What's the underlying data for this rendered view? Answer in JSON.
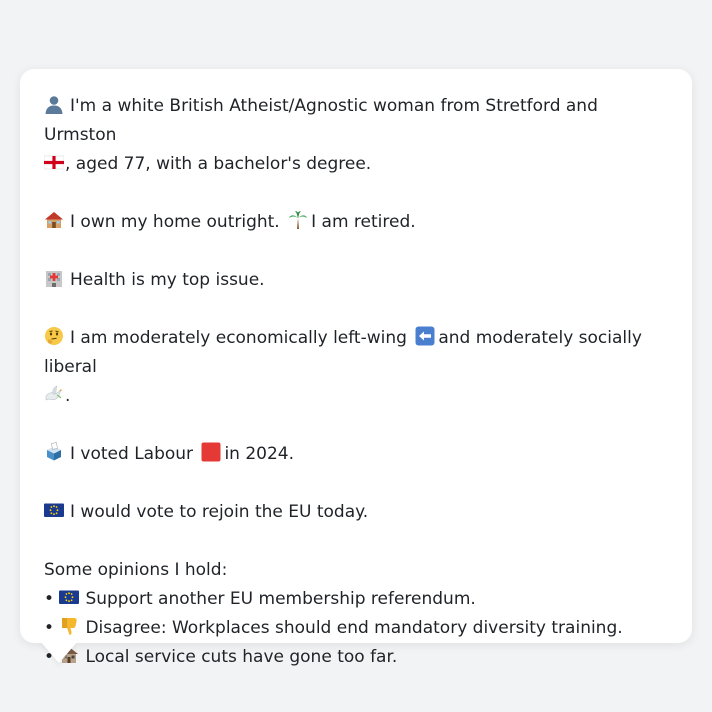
{
  "profile": {
    "identity_text": "I'm a white British Atheist/Agnostic woman from Stretford and Urmston",
    "identity_text_cont": ", aged 77, with a bachelor's degree.",
    "home_text": "I own my home outright.",
    "retired_text": "I am retired.",
    "issue_text": "Health is my top issue.",
    "economics_text_a": "I am moderately economically left-wing",
    "economics_text_b": "and moderately socially liberal",
    "economics_text_end": ".",
    "vote_text_a": "I voted Labour",
    "vote_text_b": "in 2024.",
    "eu_text": "I would vote to rejoin the EU today.",
    "opinions_heading": "Some opinions I hold:",
    "opinions": [
      {
        "bullet": "•",
        "text": "Support another EU membership referendum."
      },
      {
        "bullet": "•",
        "text": "Disagree: Workplaces should end mandatory diversity training."
      },
      {
        "bullet": "•",
        "text": "Local service cuts have gone too far."
      }
    ]
  },
  "icons": {
    "identity": "person-silhouette-icon",
    "flag": "england-flag-icon",
    "home": "house-icon",
    "retired": "palm-tree-icon",
    "health": "hospital-icon",
    "thinking": "thinking-face-icon",
    "left": "left-arrow-icon",
    "liberal": "dove-icon",
    "ballot": "ballot-box-icon",
    "labour": "red-square-icon",
    "eu": "eu-flag-icon",
    "thumbs_down": "thumbs-down-icon",
    "derelict": "derelict-house-icon"
  },
  "colors": {
    "background": "#f1f3f5",
    "bubble": "#ffffff",
    "text": "#1f2328",
    "labour_red": "#e53935",
    "eu_blue": "#1a3a8f"
  }
}
